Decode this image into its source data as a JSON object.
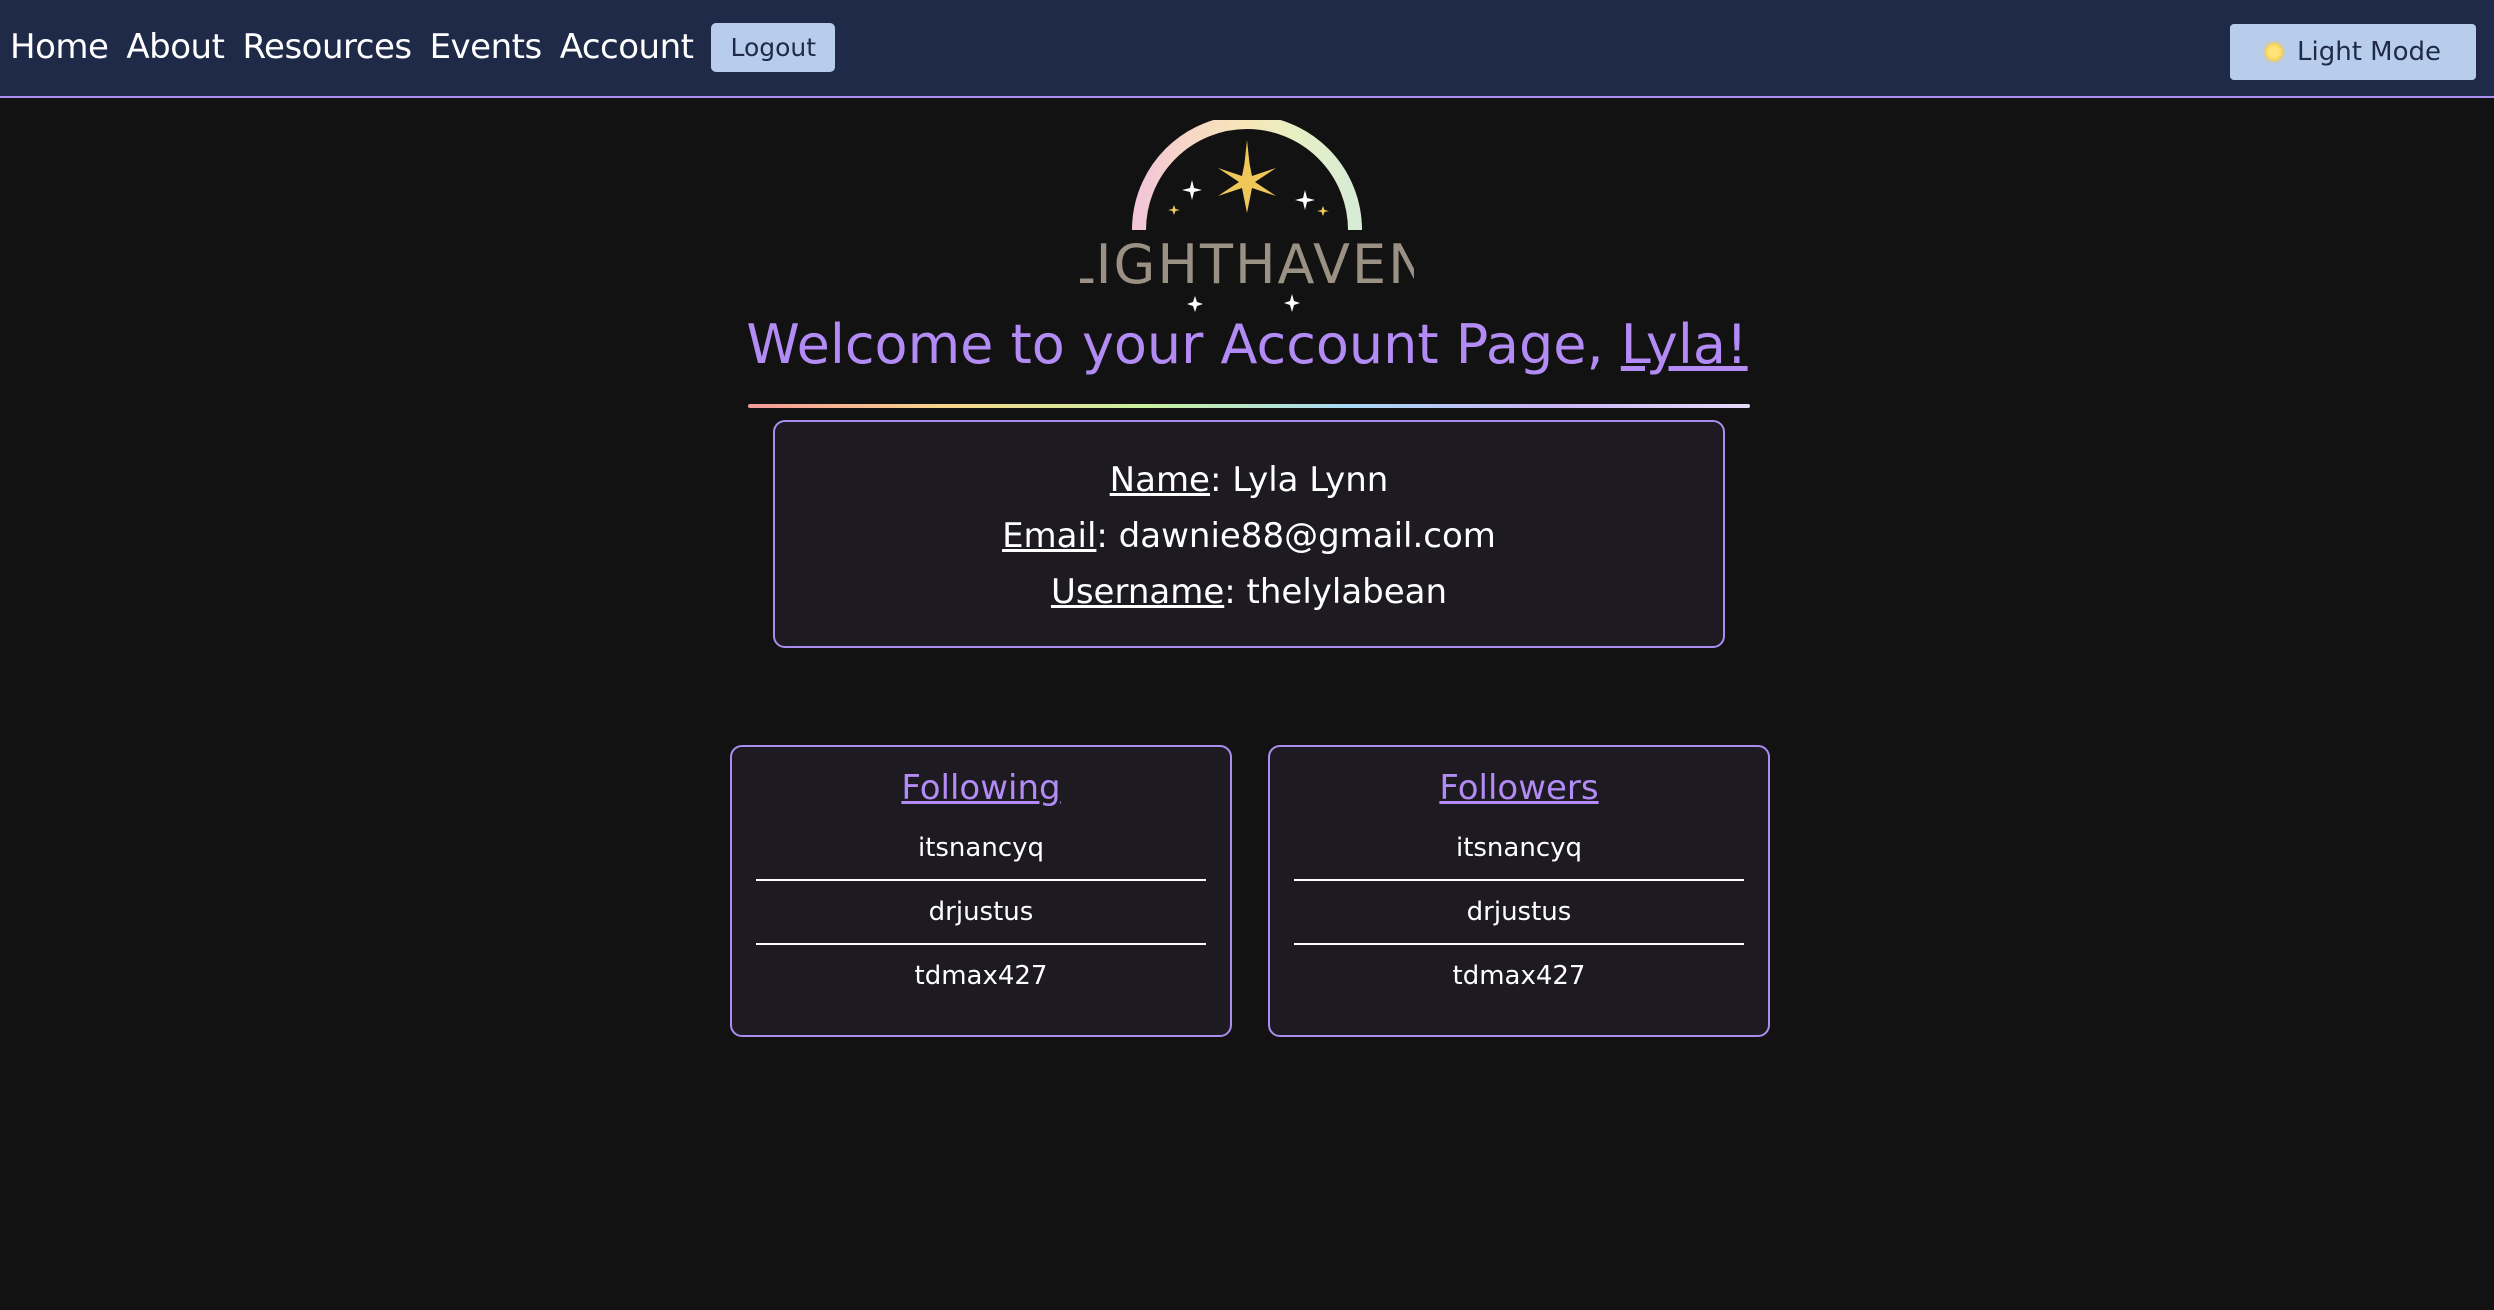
{
  "nav": {
    "links": [
      "Home",
      "About",
      "Resources",
      "Events",
      "Account"
    ],
    "logout_label": "Logout",
    "mode_label": "Light Mode",
    "mode_icon": "sun-icon"
  },
  "logo": {
    "text": "LIGHTHAVEN"
  },
  "welcome": {
    "prefix": "Welcome to your Account Page, ",
    "name": "Lyla!"
  },
  "profile": {
    "name_key": "Name",
    "name_value": ": Lyla Lynn",
    "email_key": "Email",
    "email_value": ": dawnie88@gmail.com",
    "username_key": "Username",
    "username_value": ": thelylabean"
  },
  "following": {
    "title": "Following",
    "users": [
      "itsnancyq",
      "drjustus",
      "tdmax427"
    ]
  },
  "followers": {
    "title": "Followers",
    "users": [
      "itsnancyq",
      "drjustus",
      "tdmax427"
    ]
  },
  "colors": {
    "navbar_bg": "#1e2a48",
    "page_bg": "#121212",
    "accent_purple": "#b38bf5",
    "button_bg": "#b7cdeb"
  }
}
